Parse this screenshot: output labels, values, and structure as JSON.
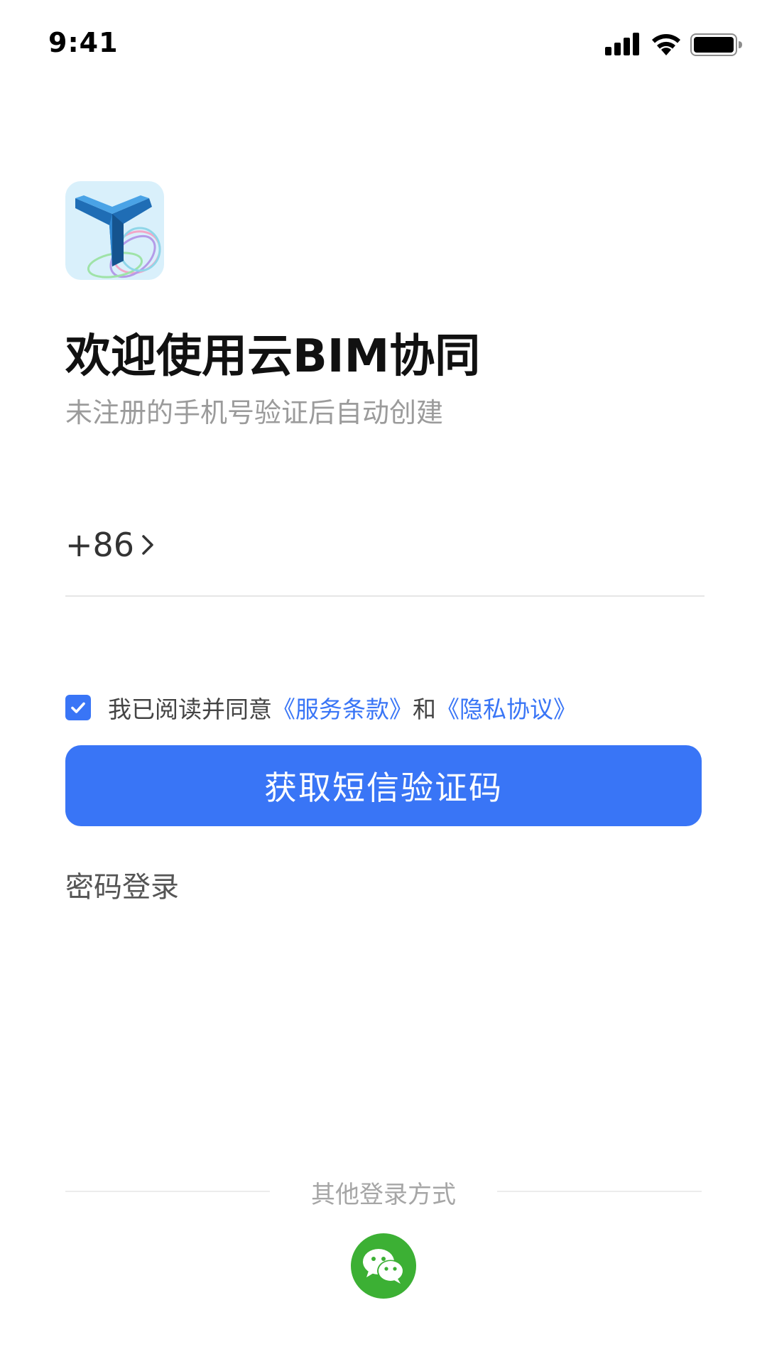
{
  "status_bar": {
    "time": "9:41"
  },
  "header": {
    "title": "欢迎使用云BIM协同",
    "subtitle": "未注册的手机号验证后自动创建"
  },
  "phone": {
    "country_code": "+86",
    "value": "",
    "placeholder": ""
  },
  "agreement": {
    "checked": true,
    "prefix": "我已阅读并同意",
    "terms_link": "《服务条款》",
    "conjunction": "和",
    "privacy_link": "《隐私协议》"
  },
  "actions": {
    "get_code_label": "获取短信验证码",
    "password_login_label": "密码登录"
  },
  "other_login": {
    "label": "其他登录方式",
    "providers": [
      {
        "icon": "wechat-icon",
        "color": "#3cb034"
      }
    ]
  },
  "colors": {
    "primary": "#3975f6",
    "link": "#3975f6",
    "wechat": "#3cb034"
  }
}
